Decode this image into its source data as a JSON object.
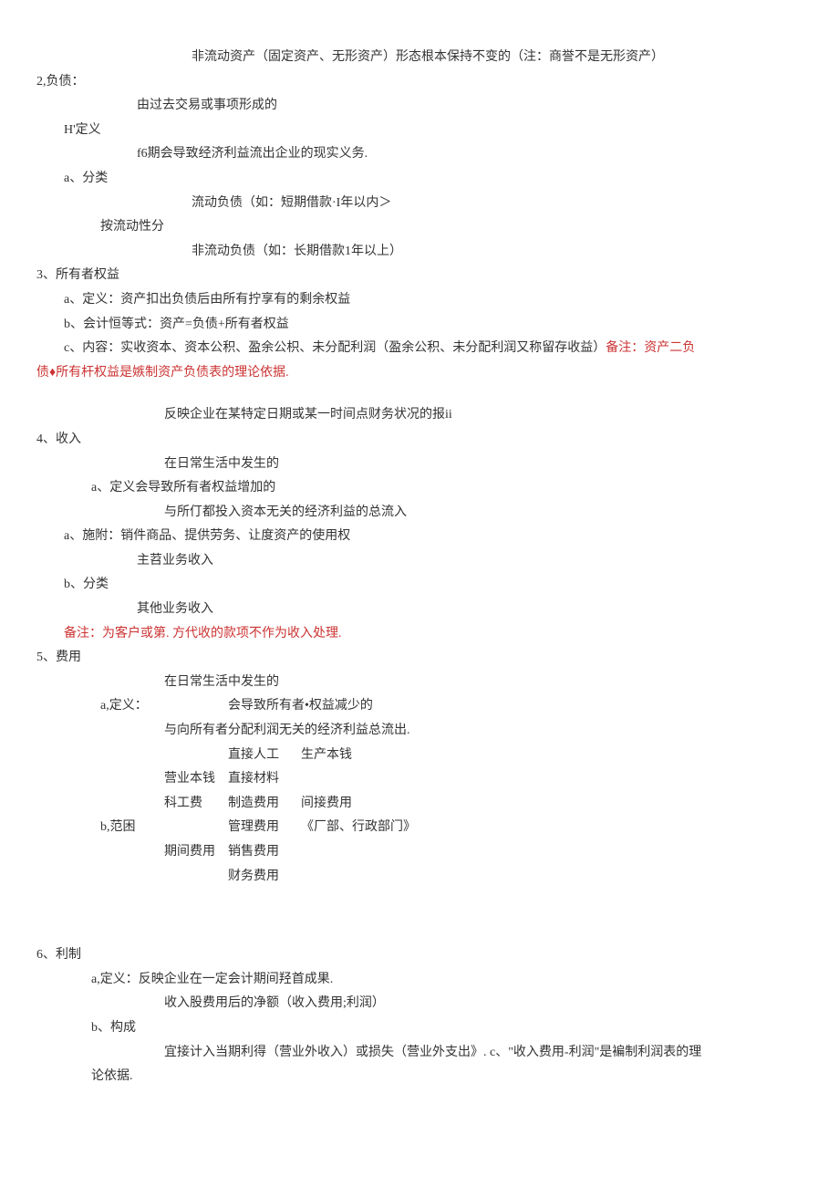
{
  "l1": "非流动资产（固定资产、无形资产）形态根本保持不变的（注：商誉不是无形资产）",
  "l2": "2,负债：",
  "l3": "由过去交易或事项形成的",
  "l4": "H'定义",
  "l5": "f6期会导致经济利益流出企业的现实义务.",
  "l6": "a、分类",
  "l7": "流动负债（如：短期借款·I年以内＞",
  "l8": "按流动性分",
  "l9": "非流动负债（如：长期借款1年以上）",
  "l10": "3、所有者权益",
  "l11": "a、定义：资产扣出负债后由所有拧享有的剩余权益",
  "l12": "b、会计恒等式：资产=负债+所有者权益",
  "l13a": "c、内容：实收资本、资本公积、盈余公枳、未分配利润（盈余公积、未分配利润又称留存收益）",
  "l13b": "备注：资产二负",
  "l13c": "债♦所有杆权益是嫉制资产负债表的理论依据.",
  "l14": "反映企业在某特定日期或某一时间点财务状况的报ii",
  "l15": "4、收入",
  "l16": "在日常生活中发生的",
  "l17": "a、定义会导致所有者权益增加的",
  "l18": "与所仃都投入资本无关的经济利益的总流入",
  "l19": "a、施附：销件商品、提供劳务、让度资产的使用权",
  "l20": "主苕业务收入",
  "l21": "b、分类",
  "l22": "其他业务收入",
  "l23": "备注：为客户或第. 方代收的款项不作为收入处理.",
  "l24": "5、费用",
  "l25": "在日常生活中发生的",
  "l26_a": "a,定义：",
  "l26_b": "会导致所有者•权益减少的",
  "l27": "与向所有者分配利润无关的经济利益总流出.",
  "t_r1_c3": "直接人工",
  "t_r1_c4": "生产本钱",
  "t_r2_c2": "营业本钱",
  "t_r2_c3": "直接材料",
  "t_r3_c2": "科工费",
  "t_r3_c3": "制造费用",
  "t_r3_c4": "间接费用",
  "t_r4_c1": "b,范困",
  "t_r4_c3": "管理费用",
  "t_r4_c4": "《厂部、行政部门》",
  "t_r5_c2": "期间费用",
  "t_r5_c3": "销售费用",
  "t_r6_c3": "财务费用",
  "l28": "6、利制",
  "l29": "a,定义：反映企业在一定会计期间羟首成果.",
  "l30": "收入股费用后的净额（收入费用;利润）",
  "l31": "b、构成",
  "l32": "宜接计入当期利得（营业外收入）或损失（营业外支出》. c、\"收入费用-利润\"是褊制利润表的理",
  "l33": "论依据."
}
